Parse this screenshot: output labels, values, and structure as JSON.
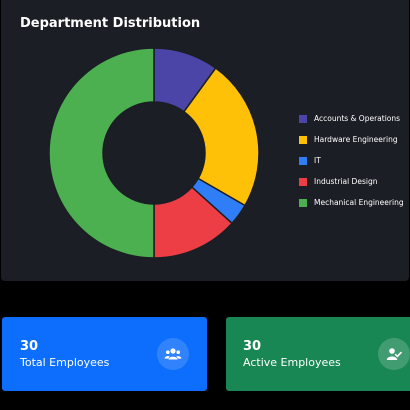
{
  "chart_card": {
    "title": "Department Distribution"
  },
  "chart_data": {
    "type": "pie",
    "title": "Department Distribution",
    "donut": true,
    "legend_position": "right",
    "categories": [
      "Accounts & Operations",
      "Hardware Engineering",
      "IT",
      "Industrial Design",
      "Mechanical Engineering"
    ],
    "values": [
      3,
      7,
      1,
      4,
      15
    ],
    "colors": [
      "#4b45a8",
      "#ffc107",
      "#2f7ef7",
      "#ee3e45",
      "#4caf50"
    ]
  },
  "stats": [
    {
      "value": "30",
      "label": "Total Employees",
      "icon": "users-icon",
      "color": "#0d6efd"
    },
    {
      "value": "30",
      "label": "Active Employees",
      "icon": "user-check-icon",
      "color": "#198754"
    }
  ]
}
